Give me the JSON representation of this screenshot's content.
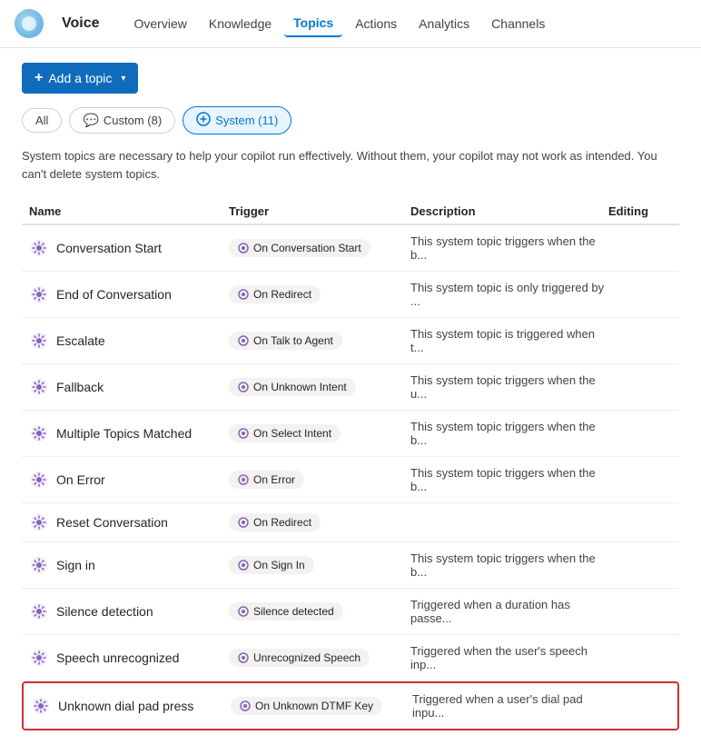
{
  "app": {
    "logo_alt": "Voice app logo",
    "title": "Voice",
    "nav_items": [
      "Overview",
      "Knowledge",
      "Topics",
      "Actions",
      "Analytics",
      "Channels"
    ],
    "active_nav": "Topics"
  },
  "toolbar": {
    "add_button_label": "Add a topic",
    "add_button_chevron": "▾"
  },
  "filters": {
    "all_label": "All",
    "custom_label": "Custom (8)",
    "system_label": "System (11)"
  },
  "info": {
    "text": "System topics are necessary to help your copilot run effectively. Without them, your copilot may not work as intended. You can't delete system topics."
  },
  "table": {
    "columns": [
      "Name",
      "Trigger",
      "Description",
      "Editing"
    ],
    "rows": [
      {
        "name": "Conversation Start",
        "trigger": "On Conversation Start",
        "description": "This system topic triggers when the b...",
        "highlighted": false
      },
      {
        "name": "End of Conversation",
        "trigger": "On Redirect",
        "description": "This system topic is only triggered by ...",
        "highlighted": false
      },
      {
        "name": "Escalate",
        "trigger": "On Talk to Agent",
        "description": "This system topic is triggered when t...",
        "highlighted": false
      },
      {
        "name": "Fallback",
        "trigger": "On Unknown Intent",
        "description": "This system topic triggers when the u...",
        "highlighted": false
      },
      {
        "name": "Multiple Topics Matched",
        "trigger": "On Select Intent",
        "description": "This system topic triggers when the b...",
        "highlighted": false
      },
      {
        "name": "On Error",
        "trigger": "On Error",
        "description": "This system topic triggers when the b...",
        "highlighted": false
      },
      {
        "name": "Reset Conversation",
        "trigger": "On Redirect",
        "description": "",
        "highlighted": false
      },
      {
        "name": "Sign in",
        "trigger": "On Sign In",
        "description": "This system topic triggers when the b...",
        "highlighted": false
      },
      {
        "name": "Silence detection",
        "trigger": "Silence detected",
        "description": "Triggered when a duration has passe...",
        "highlighted": false
      },
      {
        "name": "Speech unrecognized",
        "trigger": "Unrecognized Speech",
        "description": "Triggered when the user's speech inp...",
        "highlighted": false
      },
      {
        "name": "Unknown dial pad press",
        "trigger": "On Unknown DTMF Key",
        "description": "Triggered when a user's dial pad inpu...",
        "highlighted": true
      }
    ]
  }
}
